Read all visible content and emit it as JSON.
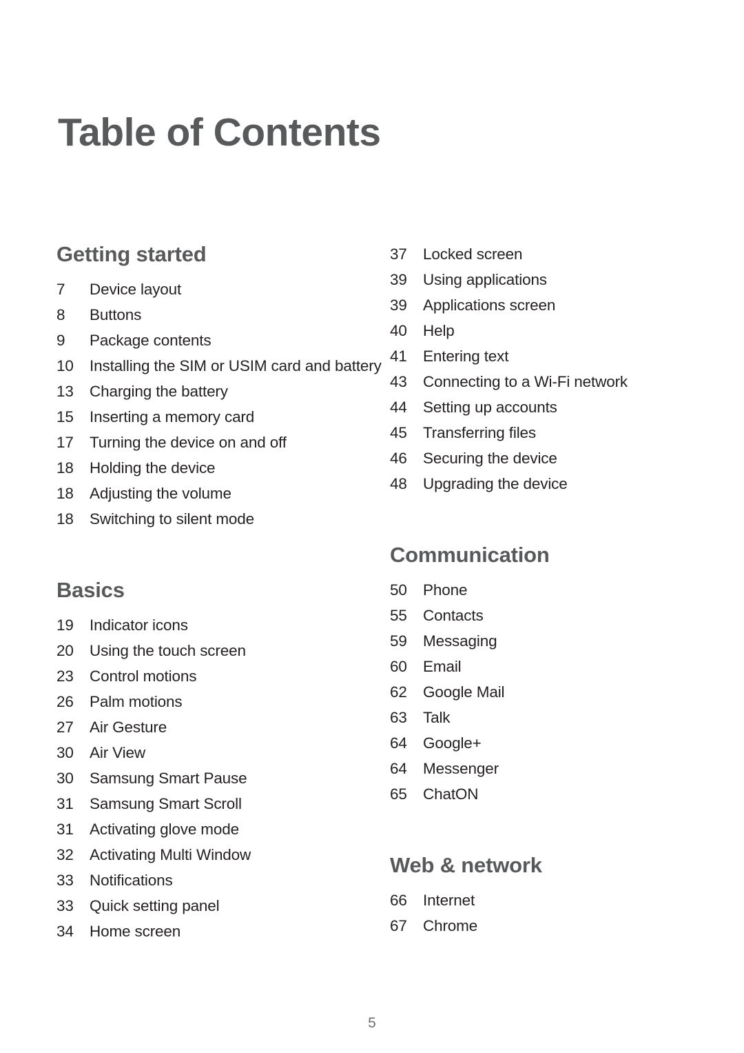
{
  "document": {
    "title": "Table of Contents",
    "folio": "5",
    "colors": {
      "heading": "#58595B",
      "body": "#231F20",
      "folio": "#6D6E71",
      "background": "#FFFFFF"
    }
  },
  "columns": {
    "left": [
      {
        "heading": "Getting started",
        "entries": [
          {
            "page": "7",
            "title": "Device layout"
          },
          {
            "page": "8",
            "title": "Buttons"
          },
          {
            "page": "9",
            "title": "Package contents"
          },
          {
            "page": "10",
            "title": "Installing the SIM or USIM card and battery"
          },
          {
            "page": "13",
            "title": "Charging the battery"
          },
          {
            "page": "15",
            "title": "Inserting a memory card"
          },
          {
            "page": "17",
            "title": "Turning the device on and off"
          },
          {
            "page": "18",
            "title": "Holding the device"
          },
          {
            "page": "18",
            "title": "Adjusting the volume"
          },
          {
            "page": "18",
            "title": "Switching to silent mode"
          }
        ]
      },
      {
        "heading": "Basics",
        "entries": [
          {
            "page": "19",
            "title": "Indicator icons"
          },
          {
            "page": "20",
            "title": "Using the touch screen"
          },
          {
            "page": "23",
            "title": "Control motions"
          },
          {
            "page": "26",
            "title": "Palm motions"
          },
          {
            "page": "27",
            "title": "Air Gesture"
          },
          {
            "page": "30",
            "title": "Air View"
          },
          {
            "page": "30",
            "title": "Samsung Smart Pause"
          },
          {
            "page": "31",
            "title": "Samsung Smart Scroll"
          },
          {
            "page": "31",
            "title": "Activating glove mode"
          },
          {
            "page": "32",
            "title": "Activating Multi Window"
          },
          {
            "page": "33",
            "title": "Notifications"
          },
          {
            "page": "33",
            "title": "Quick setting panel"
          },
          {
            "page": "34",
            "title": "Home screen"
          }
        ]
      }
    ],
    "right": [
      {
        "heading": "",
        "entries": [
          {
            "page": "37",
            "title": "Locked screen"
          },
          {
            "page": "39",
            "title": "Using applications"
          },
          {
            "page": "39",
            "title": "Applications screen"
          },
          {
            "page": "40",
            "title": "Help"
          },
          {
            "page": "41",
            "title": "Entering text"
          },
          {
            "page": "43",
            "title": "Connecting to a Wi-Fi network"
          },
          {
            "page": "44",
            "title": "Setting up accounts"
          },
          {
            "page": "45",
            "title": "Transferring files"
          },
          {
            "page": "46",
            "title": "Securing the device"
          },
          {
            "page": "48",
            "title": "Upgrading the device"
          }
        ]
      },
      {
        "heading": "Communication",
        "entries": [
          {
            "page": "50",
            "title": "Phone"
          },
          {
            "page": "55",
            "title": "Contacts"
          },
          {
            "page": "59",
            "title": "Messaging"
          },
          {
            "page": "60",
            "title": "Email"
          },
          {
            "page": "62",
            "title": "Google Mail"
          },
          {
            "page": "63",
            "title": "Talk"
          },
          {
            "page": "64",
            "title": "Google+"
          },
          {
            "page": "64",
            "title": "Messenger"
          },
          {
            "page": "65",
            "title": "ChatON"
          }
        ]
      },
      {
        "heading": "Web & network",
        "entries": [
          {
            "page": "66",
            "title": "Internet"
          },
          {
            "page": "67",
            "title": "Chrome"
          }
        ]
      }
    ]
  }
}
